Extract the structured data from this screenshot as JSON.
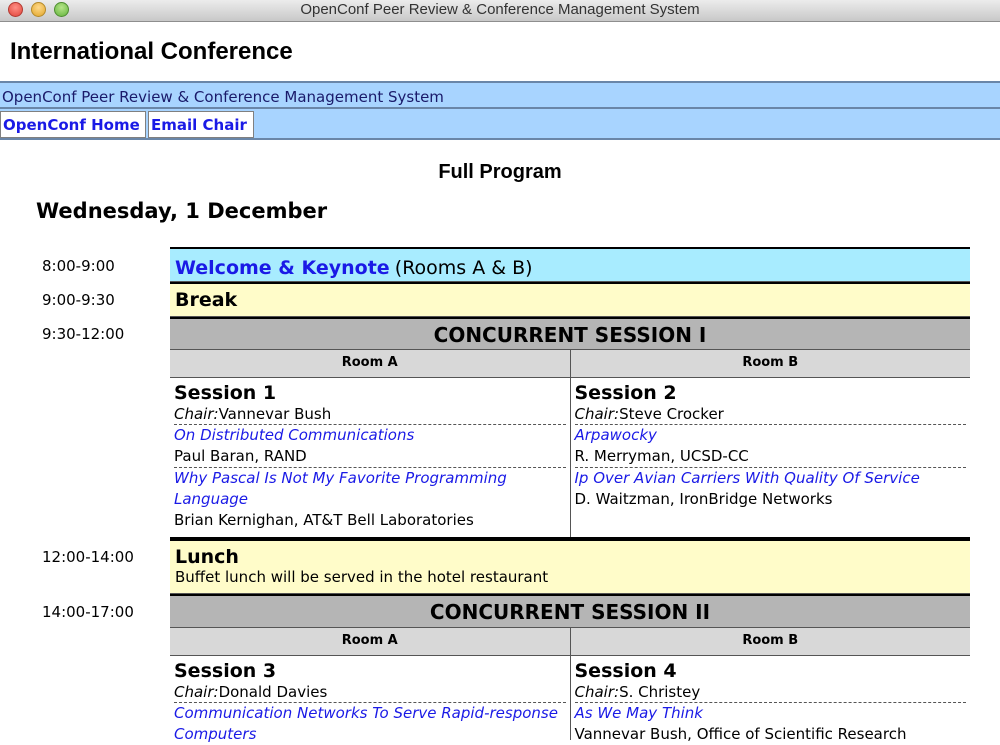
{
  "window": {
    "title": "OpenConf Peer Review & Conference Management System"
  },
  "header": {
    "conference_name": "International Conference"
  },
  "system_bar": {
    "label": "OpenConf Peer Review & Conference Management System"
  },
  "nav": {
    "home": "OpenConf Home",
    "email": "Email Chair"
  },
  "page": {
    "heading": "Full Program",
    "day": "Wednesday, 1 December"
  },
  "colors": {
    "nav_bg": "#a8d4ff",
    "keynote_bg": "#a8ecff",
    "break_bg": "#fffcc9",
    "session_header_bg": "#b5b5b5",
    "link": "#1a1ae6"
  },
  "schedule": {
    "keynote": {
      "time": "8:00-9:00",
      "title": "Welcome & Keynote",
      "room": "(Rooms A & B)"
    },
    "break": {
      "time": "9:00-9:30",
      "title": "Break"
    },
    "concurrent1": {
      "time": "9:30-12:00",
      "title": "CONCURRENT SESSION I",
      "room_a": "Room A",
      "room_b": "Room B",
      "left": {
        "name": "Session 1",
        "chair_label": "Chair:",
        "chair": "Vannevar Bush",
        "papers": [
          {
            "title": "On Distributed Communications",
            "authors": "Paul Baran, RAND"
          },
          {
            "title": "Why Pascal Is Not My Favorite Programming Language",
            "authors": "Brian Kernighan, AT&T Bell Laboratories"
          }
        ]
      },
      "right": {
        "name": "Session 2",
        "chair_label": "Chair:",
        "chair": "Steve Crocker",
        "papers": [
          {
            "title": "Arpawocky",
            "authors": "R. Merryman, UCSD-CC"
          },
          {
            "title": "Ip Over Avian Carriers With Quality Of Service",
            "authors": "D. Waitzman, IronBridge Networks"
          }
        ]
      }
    },
    "lunch": {
      "time": "12:00-14:00",
      "title": "Lunch",
      "note": "Buffet lunch will be served in the hotel restaurant"
    },
    "concurrent2": {
      "time": "14:00-17:00",
      "title": "CONCURRENT SESSION II",
      "room_a": "Room A",
      "room_b": "Room B",
      "left": {
        "name": "Session 3",
        "chair_label": "Chair:",
        "chair": "Donald Davies",
        "papers": [
          {
            "title": "Communication Networks To Serve Rapid-response Computers",
            "authors": ""
          }
        ]
      },
      "right": {
        "name": "Session 4",
        "chair_label": "Chair:",
        "chair": "S. Christey",
        "papers": [
          {
            "title": "As We May Think",
            "authors": "Vannevar Bush, Office of Scientific Research"
          }
        ]
      }
    }
  }
}
